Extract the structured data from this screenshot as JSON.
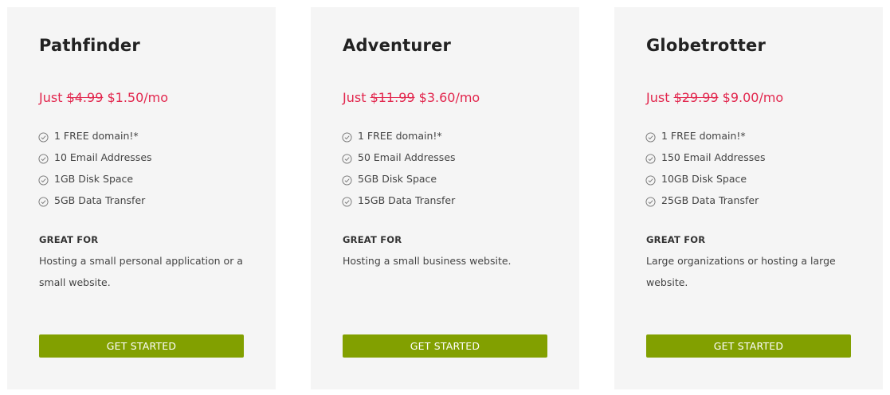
{
  "colors": {
    "card_background": "#f5f5f5",
    "price_red": "#e2264d",
    "button_green": "#82a000",
    "title_dark": "#222222"
  },
  "plans": [
    {
      "name": "Pathfinder",
      "price_prefix": "Just",
      "old_price": "$4.99",
      "new_price": "$1.50/mo",
      "features": [
        {
          "icon": "check-circle-icon",
          "text": "1 FREE domain!*"
        },
        {
          "icon": "check-circle-icon",
          "text": "10 Email Addresses"
        },
        {
          "icon": "check-circle-icon",
          "text": "1GB Disk Space"
        },
        {
          "icon": "check-circle-icon",
          "text": "5GB Data Transfer"
        }
      ],
      "great_for_label": "GREAT FOR",
      "great_for_text": "Hosting a small personal application or a small website.",
      "button_label": "GET STARTED"
    },
    {
      "name": "Adventurer",
      "price_prefix": "Just",
      "old_price": "$11.99",
      "new_price": "$3.60/mo",
      "features": [
        {
          "icon": "check-circle-icon",
          "text": "1 FREE domain!*"
        },
        {
          "icon": "check-circle-icon",
          "text": "50 Email Addresses"
        },
        {
          "icon": "check-circle-icon",
          "text": "5GB Disk Space"
        },
        {
          "icon": "check-circle-icon",
          "text": "15GB Data Transfer"
        }
      ],
      "great_for_label": "GREAT FOR",
      "great_for_text": "Hosting a small business website.",
      "button_label": "GET STARTED"
    },
    {
      "name": "Globetrotter",
      "price_prefix": "Just",
      "old_price": "$29.99",
      "new_price": "$9.00/mo",
      "features": [
        {
          "icon": "check-circle-icon",
          "text": "1 FREE domain!*"
        },
        {
          "icon": "check-circle-icon",
          "text": "150 Email Addresses"
        },
        {
          "icon": "check-circle-icon",
          "text": "10GB Disk Space"
        },
        {
          "icon": "check-circle-icon",
          "text": "25GB Data Transfer"
        }
      ],
      "great_for_label": "GREAT FOR",
      "great_for_text": "Large organizations or hosting a large website.",
      "button_label": "GET STARTED"
    }
  ]
}
